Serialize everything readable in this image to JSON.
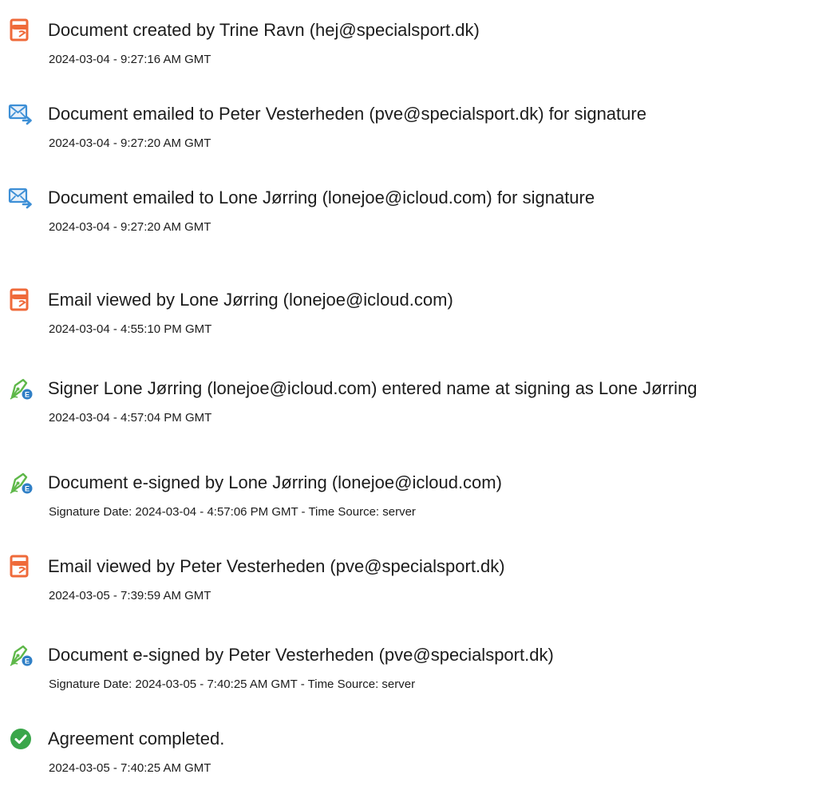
{
  "events": [
    {
      "icon": "document-created-icon",
      "title": "Document created by Trine Ravn (hej@specialsport.dk)",
      "detail": "2024-03-04 - 9:27:16 AM GMT"
    },
    {
      "icon": "email-sent-icon",
      "title": "Document emailed to Peter Vesterheden (pve@specialsport.dk) for signature",
      "detail": "2024-03-04 - 9:27:20 AM GMT"
    },
    {
      "icon": "email-sent-icon",
      "title": "Document emailed to Lone Jørring (lonejoe@icloud.com) for signature",
      "detail": "2024-03-04 - 9:27:20 AM GMT"
    },
    {
      "icon": "document-viewed-icon",
      "title": "Email viewed by Lone Jørring (lonejoe@icloud.com)",
      "detail": "2024-03-04 - 4:55:10 PM GMT"
    },
    {
      "icon": "e-sign-pen-icon",
      "title": "Signer Lone Jørring (lonejoe@icloud.com) entered name at signing as Lone Jørring",
      "detail": "2024-03-04 - 4:57:04 PM GMT"
    },
    {
      "icon": "e-sign-pen-icon",
      "title": "Document e-signed by Lone Jørring (lonejoe@icloud.com)",
      "detail": "Signature Date: 2024-03-04 - 4:57:06 PM GMT - Time Source: server"
    },
    {
      "icon": "document-viewed-icon",
      "title": "Email viewed by Peter Vesterheden (pve@specialsport.dk)",
      "detail": "2024-03-05 - 7:39:59 AM GMT"
    },
    {
      "icon": "e-sign-pen-icon",
      "title": "Document e-signed by Peter Vesterheden (pve@specialsport.dk)",
      "detail": "Signature Date: 2024-03-05 - 7:40:25 AM GMT - Time Source: server"
    },
    {
      "icon": "check-circle-icon",
      "title": "Agreement completed.",
      "detail": "2024-03-05 - 7:40:25 AM GMT"
    }
  ],
  "colors": {
    "document_icon": "#ef6a3a",
    "email_icon": "#3d8fd6",
    "esign_icon": "#5fb84a",
    "esign_badge": "#2f7fc6",
    "complete_icon": "#3aa64a",
    "text": "#1c1c1c"
  }
}
